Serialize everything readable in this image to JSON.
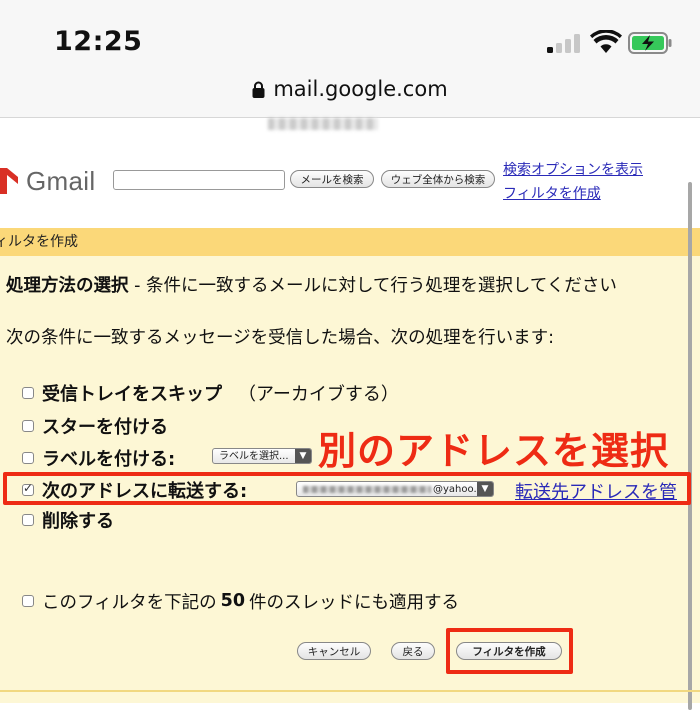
{
  "status_bar": {
    "time": "12:25"
  },
  "browser": {
    "url": "mail.google.com"
  },
  "gmail_header": {
    "logo_text": "Gmail",
    "search_placeholder": "",
    "search_mail_button": "メールを検索",
    "search_web_button": "ウェブ全体から検索",
    "show_search_options_link": "検索オプションを表示",
    "create_filter_link": "フィルタを作成"
  },
  "filter_panel": {
    "heading": "ィルタを作成",
    "section_title": "処理方法の選択",
    "section_description": " - 条件に一致するメールに対して行う処理を選択してください",
    "condition_text": "次の条件に一致するメッセージを受信した場合、次の処理を行います:",
    "options": [
      {
        "label": "受信トレイをスキップ",
        "sub": "（アーカイブする）",
        "checked": false
      },
      {
        "label": "スターを付ける",
        "sub": "",
        "checked": false
      },
      {
        "label": "ラベルを付ける:",
        "sub": "",
        "checked": false
      },
      {
        "label": "次のアドレスに転送する:",
        "sub": "",
        "checked": true
      },
      {
        "label": "削除する",
        "sub": "",
        "checked": false
      }
    ],
    "label_select_value": "ラベルを選択...",
    "forward_select_value": "@yahoo.co.jp",
    "manage_forwarding_link": "転送先アドレスを管",
    "annotation": "別のアドレスを選択",
    "apply_text_before": "このフィルタを下記の",
    "apply_count": "50",
    "apply_text_after": "件のスレッドにも適用する",
    "cancel_button": "キャンセル",
    "back_button": "戻る",
    "create_button": "フィルタを作成"
  },
  "colors": {
    "panel_bg": "#fdf7d5",
    "panel_header": "#fbd879",
    "annotation_red": "#ee2b14",
    "link_blue": "#2a2ab8"
  }
}
